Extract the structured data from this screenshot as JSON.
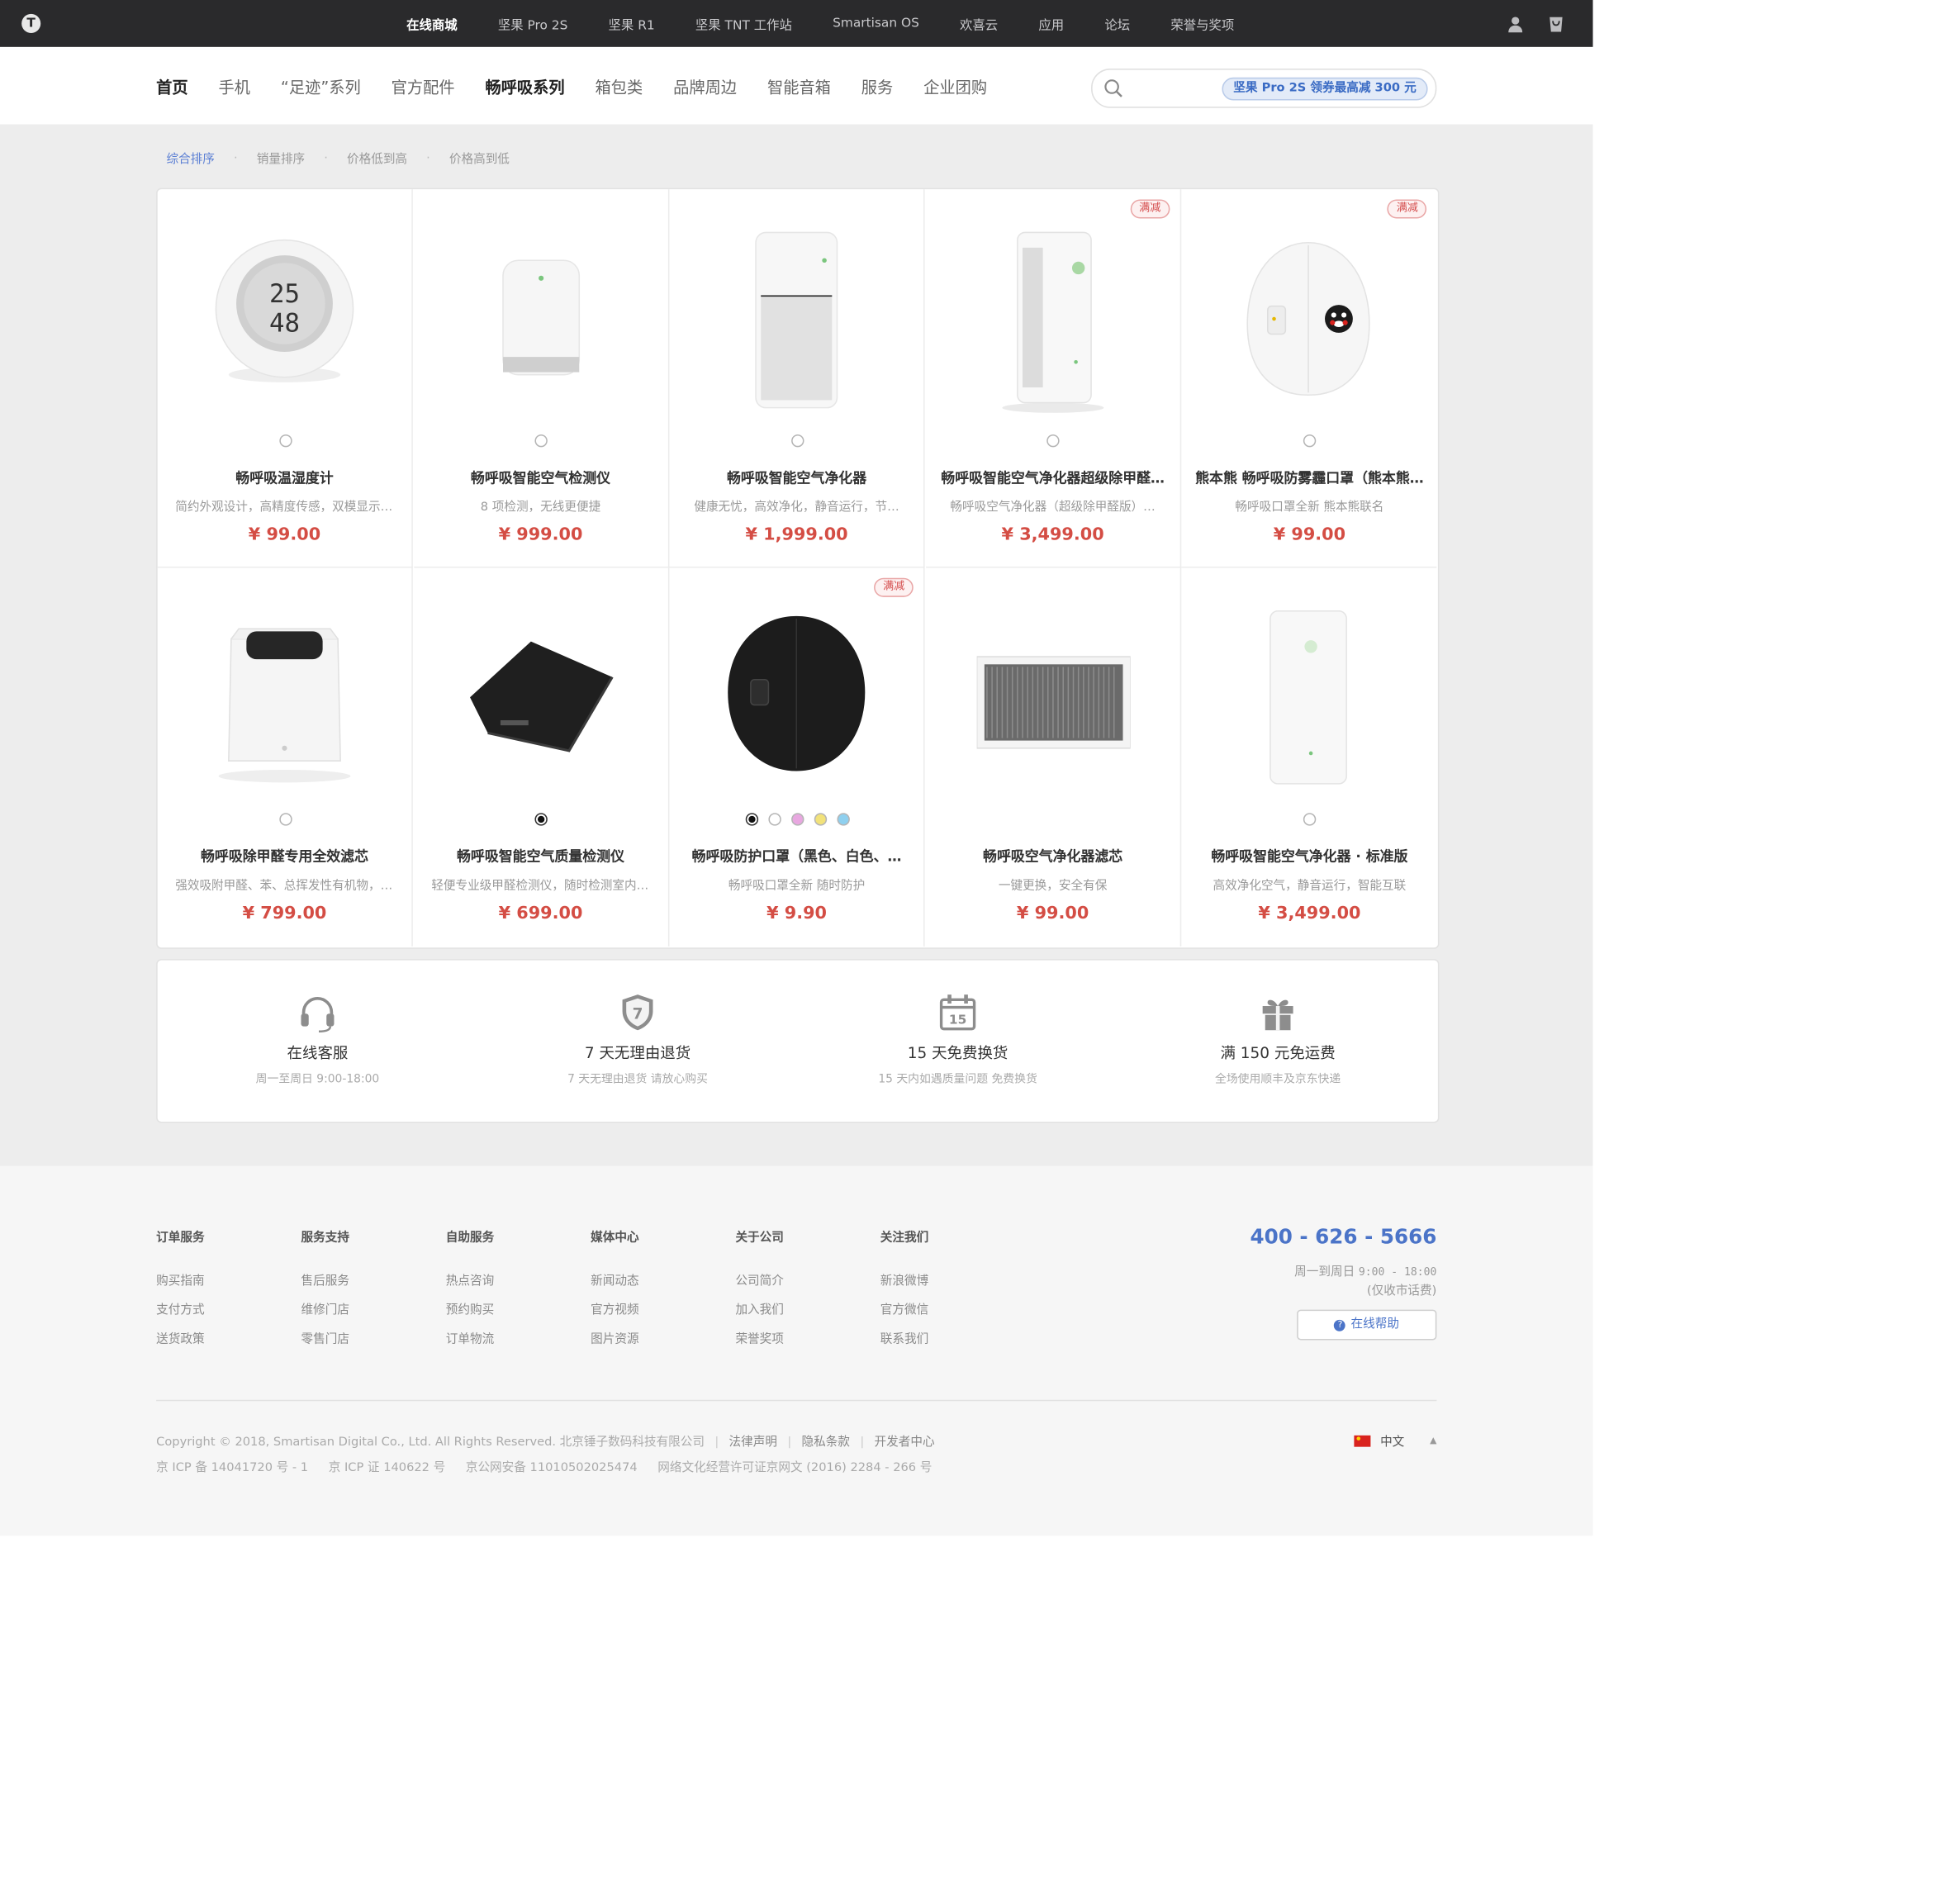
{
  "top_nav": {
    "logo": "T",
    "items": [
      "在线商城",
      "坚果 Pro 2S",
      "坚果 R1",
      "坚果 TNT 工作站",
      "Smartisan OS",
      "欢喜云",
      "应用",
      "论坛",
      "荣誉与奖项"
    ],
    "active_index": 0,
    "icons": [
      "user-icon",
      "cart-icon"
    ]
  },
  "category_nav": {
    "items": [
      "首页",
      "手机",
      "“足迹”系列",
      "官方配件",
      "畅呼吸系列",
      "箱包类",
      "品牌周边",
      "智能音箱",
      "服务",
      "企业团购"
    ],
    "bold_indices": [
      0,
      4
    ],
    "search_promo": "坚果 Pro 2S 领券最高减 300 元"
  },
  "sort_options": [
    "综合排序",
    "销量排序",
    "价格低到高",
    "价格高到低"
  ],
  "sort_active_index": 0,
  "products": [
    {
      "name": "畅呼吸温湿度计",
      "desc": "简约外观设计，高精度传感，双模显示，…",
      "price": "¥ 99.00",
      "badge": "",
      "swatches": [
        "#ffffff"
      ],
      "selected_swatch": -1
    },
    {
      "name": "畅呼吸智能空气检测仪",
      "desc": "8 项检测，无线更便捷",
      "price": "¥ 999.00",
      "badge": "",
      "swatches": [
        "#ffffff"
      ],
      "selected_swatch": -1
    },
    {
      "name": "畅呼吸智能空气净化器",
      "desc": "健康无忧，高效净化，静音运行，节…",
      "price": "¥ 1,999.00",
      "badge": "",
      "swatches": [
        "#ffffff"
      ],
      "selected_swatch": -1
    },
    {
      "name": "畅呼吸智能空气净化器超级除甲醛…",
      "desc": "畅呼吸空气净化器（超级除甲醛版）…",
      "price": "¥ 3,499.00",
      "badge": "满减",
      "swatches": [
        "#ffffff"
      ],
      "selected_swatch": -1
    },
    {
      "name": "熊本熊 畅呼吸防雾霾口罩（熊本熊…",
      "desc": "畅呼吸口罩全新 熊本熊联名",
      "price": "¥ 99.00",
      "badge": "满减",
      "swatches": [
        "#ffffff"
      ],
      "selected_swatch": -1
    },
    {
      "name": "畅呼吸除甲醛专用全效滤芯",
      "desc": "强效吸附甲醛、苯、总挥发性有机物，去…",
      "price": "¥ 799.00",
      "badge": "",
      "swatches": [
        "#ffffff"
      ],
      "selected_swatch": -1
    },
    {
      "name": "畅呼吸智能空气质量检测仪",
      "desc": "轻便专业级甲醛检测仪，随时检测室内空气",
      "price": "¥ 699.00",
      "badge": "",
      "swatches": [
        "#111111"
      ],
      "selected_swatch": 0
    },
    {
      "name": "畅呼吸防护口罩（黑色、白色、…",
      "desc": "畅呼吸口罩全新 随时防护",
      "price": "¥ 9.90",
      "badge": "满减",
      "swatches": [
        "#111111",
        "#ffffff",
        "#e8a7e0",
        "#f2e27a",
        "#8fd0ef"
      ],
      "selected_swatch": 0
    },
    {
      "name": "畅呼吸空气净化器滤芯",
      "desc": "一键更换，安全有保",
      "price": "¥ 99.00",
      "badge": "",
      "swatches": [],
      "selected_swatch": -1
    },
    {
      "name": "畅呼吸智能空气净化器 · 标准版",
      "desc": "高效净化空气，静音运行，智能互联",
      "price": "¥ 3,499.00",
      "badge": "",
      "swatches": [
        "#ffffff"
      ],
      "selected_swatch": -1
    }
  ],
  "services": [
    {
      "icon": "headset-icon",
      "title": "在线客服",
      "desc": "周一至周日 9:00-18:00"
    },
    {
      "icon": "shield-7-icon",
      "title": "7 天无理由退货",
      "desc": "7 天无理由退货 请放心购买"
    },
    {
      "icon": "calendar-15-icon",
      "title": "15 天免费换货",
      "desc": "15 天内如遇质量问题 免费换货"
    },
    {
      "icon": "gift-icon",
      "title": "满 150 元免运费",
      "desc": "全场使用顺丰及京东快递"
    }
  ],
  "footer": {
    "columns": [
      {
        "title": "订单服务",
        "links": [
          "购买指南",
          "支付方式",
          "送货政策"
        ]
      },
      {
        "title": "服务支持",
        "links": [
          "售后服务",
          "维修门店",
          "零售门店"
        ]
      },
      {
        "title": "自助服务",
        "links": [
          "热点咨询",
          "预约购买",
          "订单物流"
        ]
      },
      {
        "title": "媒体中心",
        "links": [
          "新闻动态",
          "官方视频",
          "图片资源"
        ]
      },
      {
        "title": "关于公司",
        "links": [
          "公司简介",
          "加入我们",
          "荣誉奖项"
        ]
      },
      {
        "title": "关注我们",
        "links": [
          "新浪微博",
          "官方微信",
          "联系我们"
        ]
      }
    ],
    "phone": "400 - 626 - 5666",
    "hours_label": "周一到周日",
    "hours_time": "9:00 - 18:00",
    "hours_note": "(仅收市话费)",
    "help_button": "在线帮助",
    "copyright": "Copyright © 2018, Smartisan Digital Co., Ltd. All Rights Reserved. 北京锤子数码科技有限公司",
    "legal_links": [
      "法律声明",
      "隐私条款",
      "开发者中心"
    ],
    "icp": [
      "京 ICP 备 14041720 号 - 1",
      "京 ICP 证 140622 号",
      "京公网安备 11010502025474",
      "网络文化经营许可证京网文 (2016) 2284 - 266 号"
    ],
    "language": "中文"
  },
  "colors": {
    "top_bar": "#2a2a2c",
    "accent_blue": "#4b74c8",
    "price_red": "#d44d44",
    "page_gray": "#ededed"
  }
}
